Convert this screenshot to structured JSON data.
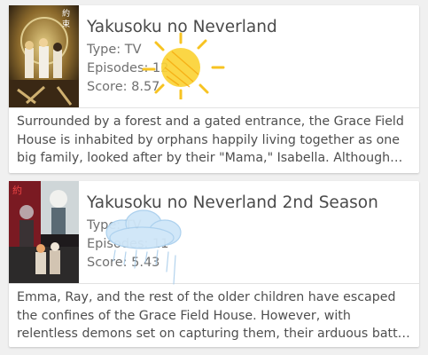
{
  "cards": [
    {
      "title": "Yakusoku no Neverland",
      "type": "Type: TV",
      "episodes": "Episodes: 12",
      "score": "Score: 8.57",
      "synopsis": "Surrounded by a forest and a gated entrance, the Grace Field House is inhabited by orphans happily living together as one big family, looked after by their \"Mama,\" Isabella. Although the…"
    },
    {
      "title": "Yakusoku no Neverland 2nd Season",
      "type": "Type: TV",
      "episodes": "Episodes: 11",
      "score": "Score: 5.43",
      "synopsis": "Emma, Ray, and the rest of the older children have escaped the confines of the Grace Field House. However, with relentless demons set on capturing them, their arduous battle for freedo…"
    }
  ],
  "overlays": [
    "sun-icon",
    "rain-cloud-icon"
  ]
}
